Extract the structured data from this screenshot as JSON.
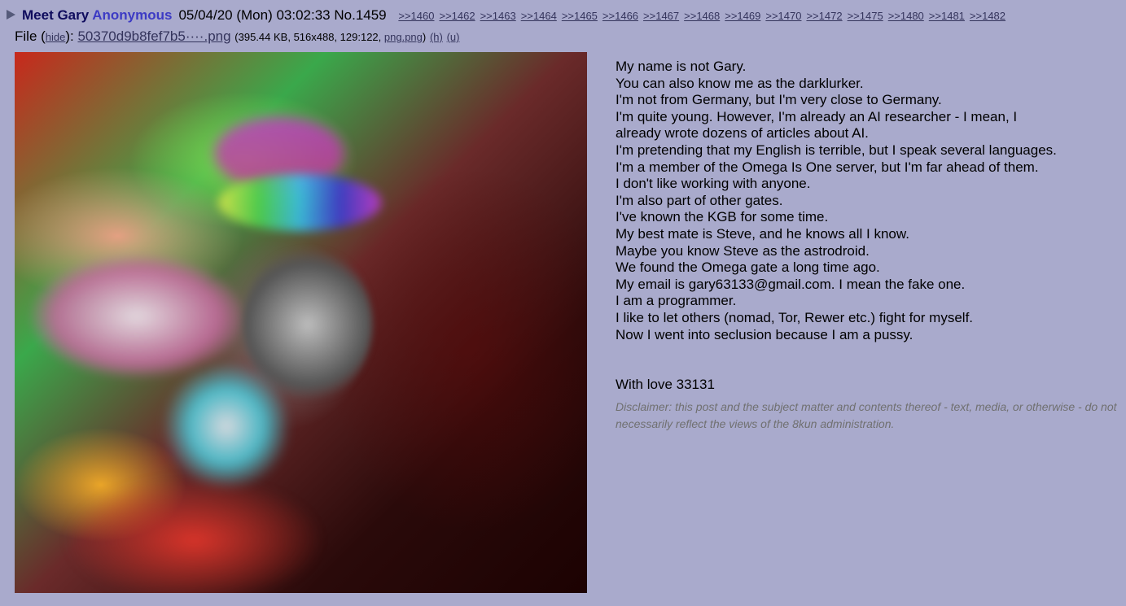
{
  "post": {
    "subject": "Meet Gary",
    "name": "Anonymous",
    "datetime": "05/04/20 (Mon) 03:02:33",
    "post_number": "No.1459",
    "backlinks": [
      ">>1460",
      ">>1462",
      ">>1463",
      ">>1464",
      ">>1465",
      ">>1466",
      ">>1467",
      ">>1468",
      ">>1469",
      ">>1470",
      ">>1472",
      ">>1475",
      ">>1480",
      ">>1481",
      ">>1482"
    ]
  },
  "file": {
    "prefix": "File (",
    "hide_label": "hide",
    "colon": "): ",
    "filename": "50370d9b8fef7b5····.png",
    "meta_open": "(395.44 KB, 516x488, 129:122, ",
    "original_name": "png.png",
    "meta_close": ")",
    "h_label": "(h)",
    "u_label": "(u)"
  },
  "image": {
    "alt": "blurred glitch-colored photo of a man"
  },
  "body": {
    "lines": [
      "My name is not Gary.",
      "You can also know me as the darklurker.",
      "I'm not from Germany, but I'm very close to Germany.",
      "I'm quite young. However, I'm already an AI researcher - I mean, I already wrote dozens of articles about AI.",
      "I'm pretending that my English is terrible, but I speak several languages.",
      "I'm a member of the Omega Is One server, but I'm far ahead of them.",
      "I don't like working with anyone.",
      "I'm also part of other gates.",
      "I've known the KGB for some time.",
      "My best mate is Steve, and he knows all I know.",
      "Maybe you know Steve as the astrodroid.",
      "We found the Omega gate a long time ago.",
      "My email is gary63133@gmail.com. I mean the fake one.",
      "I am a programmer.",
      "I like to let others (nomad, Tor, Rewer etc.) fight for myself.",
      "Now I went into seclusion because I am a pussy."
    ],
    "signoff": "With love 33131",
    "disclaimer": "Disclaimer: this post and the subject matter and contents thereof - text, media, or otherwise - do not necessarily reflect the views of the 8kun administration."
  },
  "colors": {
    "background": "#a9aacc",
    "subject": "#0f0c5d",
    "name": "#3d3bc4",
    "link": "#34345c",
    "disclaimer": "#707070"
  }
}
